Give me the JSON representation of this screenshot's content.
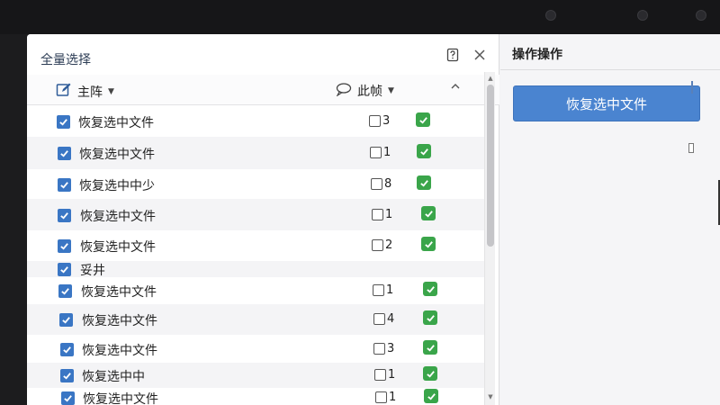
{
  "dialog": {
    "title": "全量选择",
    "columns": {
      "left_label": "主阵",
      "right_label": "此帧"
    },
    "rows": [
      {
        "label": "恢复选中文件",
        "count": "3"
      },
      {
        "label": "恢复选中文件",
        "count": "1"
      },
      {
        "label": "恢复选中中少",
        "count": "8"
      },
      {
        "label": "恢复选中文件",
        "count": "1"
      },
      {
        "label": "恢复选中文件",
        "count": "2"
      },
      {
        "label": "妥井",
        "count": ""
      },
      {
        "label": "恢复选中文件",
        "count": "1"
      },
      {
        "label": "恢复选中文件",
        "count": "4"
      },
      {
        "label": "恢复选中文件",
        "count": "3"
      },
      {
        "label": "恢复选中中",
        "count": "1"
      },
      {
        "label": "恢复选中文件",
        "count": "1"
      }
    ]
  },
  "side_panel": {
    "title": "操作操作",
    "primary_button": "恢复选中文件"
  },
  "icons": {
    "help": "help-icon",
    "close": "close-icon",
    "edit": "edit-icon",
    "comment": "comment-icon",
    "sort": "chevron-up-icon"
  },
  "colors": {
    "accent": "#4a84d0",
    "checkbox_blue": "#3a76c4",
    "check_green": "#3aa54a"
  }
}
